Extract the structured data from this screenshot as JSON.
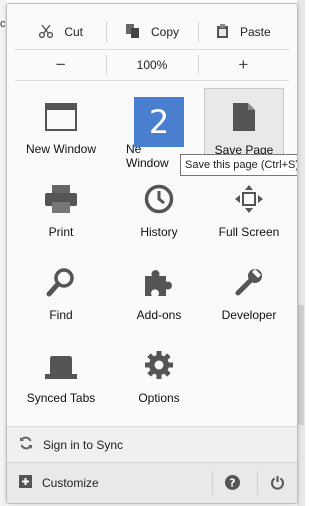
{
  "edge_text": "c",
  "edit": {
    "cut": "Cut",
    "copy": "Copy",
    "paste": "Paste"
  },
  "zoom": {
    "out": "−",
    "level": "100%",
    "in": "+"
  },
  "grid": [
    {
      "label": "New Window",
      "icon": "window-icon"
    },
    {
      "label": "New Private Window",
      "visible_label": "Ne\nWindow",
      "icon": "private-window-icon"
    },
    {
      "label": "Save Page",
      "icon": "page-icon"
    },
    {
      "label": "Print",
      "icon": "printer-icon"
    },
    {
      "label": "History",
      "icon": "clock-icon"
    },
    {
      "label": "Full Screen",
      "icon": "fullscreen-icon"
    },
    {
      "label": "Find",
      "icon": "magnifier-icon"
    },
    {
      "label": "Add-ons",
      "icon": "puzzle-icon"
    },
    {
      "label": "Developer",
      "icon": "wrench-icon"
    },
    {
      "label": "Synced Tabs",
      "icon": "synced-tabs-icon"
    },
    {
      "label": "Options",
      "icon": "gear-icon"
    }
  ],
  "badge": "2",
  "tooltip": "Save this page (Ctrl+S)",
  "footer": {
    "sync": "Sign in to Sync",
    "customize": "Customize"
  },
  "colors": {
    "badge": "#4a7fd0",
    "hover_tile": "#e9e9e9"
  }
}
